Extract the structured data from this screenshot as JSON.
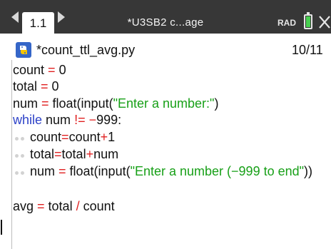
{
  "tabbar": {
    "active_tab": "1.1",
    "document_title": "*U3SB2 c...age",
    "mode": "RAD",
    "battery_level": 1.0,
    "icons": {
      "prev": "arrow-left-icon",
      "next": "arrow-right-icon",
      "battery": "battery-icon",
      "close": "close-icon"
    }
  },
  "file": {
    "icon": "python-file-icon",
    "name": "*count_ttl_avg.py",
    "page": "10/11"
  },
  "code": {
    "line1": {
      "var": "count",
      "op": " = ",
      "val": "0"
    },
    "line2": {
      "var": "total",
      "op": " = ",
      "val": "0"
    },
    "line3": {
      "var": "num",
      "op": " = ",
      "call": "float(input(",
      "str": "\"Enter a number:\"",
      "close": ")"
    },
    "line4": {
      "kw": "while",
      "var": " num ",
      "op": "!= ",
      "minus": "−",
      "val": "999:"
    },
    "line5": {
      "lhs": "count",
      "eq": "=",
      "mid": "count",
      "plus": "+",
      "val": "1"
    },
    "line6": {
      "lhs": "total",
      "eq": "=",
      "mid": "total",
      "plus": "+",
      "val": "num"
    },
    "line7": {
      "var": "num",
      "op": " = ",
      "call": "float(input(",
      "str": "\"Enter a number (−999 to end\"",
      "close": "))"
    },
    "line9": {
      "var": "avg",
      "op": " = ",
      "mid": "total ",
      "div": "/",
      "val": " count"
    }
  },
  "colors": {
    "tabbar_bg": "#373737",
    "operator": "#e02020",
    "string": "#18a018",
    "keyword": "#2d42c8",
    "battery": "#48d050"
  }
}
